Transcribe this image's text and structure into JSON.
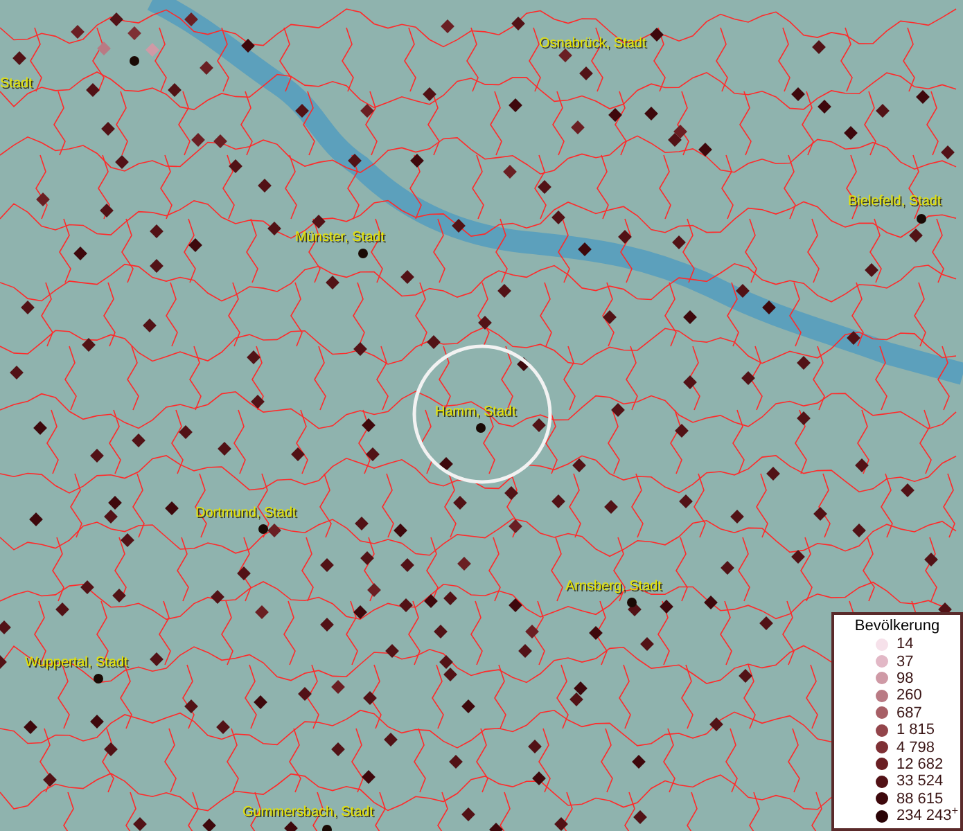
{
  "map": {
    "city_labels": [
      "Stadt",
      "Osnabrück, Stadt",
      "Münster, Stadt",
      "Bielefeld, Stadt",
      "Hamm, Stadt",
      "Dortmund, Stadt",
      "Arnsberg, Stadt",
      "Wuppertal, Stadt",
      "Gummersbach, Stadt"
    ]
  },
  "legend": {
    "title": "Bevölkerung",
    "classes": [
      {
        "label": "14",
        "color": "#f6e1ea"
      },
      {
        "label": "37",
        "color": "#e2b8c6"
      },
      {
        "label": "98",
        "color": "#cf9aa6"
      },
      {
        "label": "260",
        "color": "#b97a84"
      },
      {
        "label": "687",
        "color": "#a75f66"
      },
      {
        "label": "1 815",
        "color": "#93454b"
      },
      {
        "label": "4 798",
        "color": "#7e3035"
      },
      {
        "label": "12 682",
        "color": "#6a1f23"
      },
      {
        "label": "33 524",
        "color": "#521216"
      },
      {
        "label": "88 615",
        "color": "#3e080c"
      },
      {
        "label": "234 243$^{+}$",
        "color": "#2a0306"
      }
    ]
  }
}
